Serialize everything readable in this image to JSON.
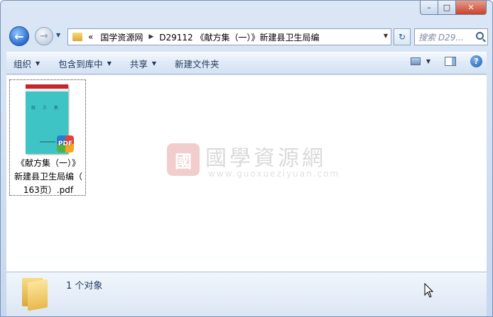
{
  "window": {
    "caption": {
      "minimize": "–",
      "maximize": "□",
      "close": "✕"
    }
  },
  "nav": {
    "back_glyph": "←",
    "forward_glyph": "→",
    "breadcrumb": [
      "国学资源网",
      "D29112 《献方集（一）》新建县卫生局编"
    ],
    "breadcrumb_prefix": "«",
    "refresh_glyph": "↻",
    "search_placeholder": "搜索 D29..."
  },
  "toolbar": {
    "organize": "组织",
    "include_library": "包含到库中",
    "share": "共享",
    "new_folder": "新建文件夹",
    "help": "?"
  },
  "content": {
    "file": {
      "name_lines": [
        "《献方集（一）》",
        "新建县卫生局编（",
        "163页）.pdf"
      ],
      "thumb_title": "献 方 集",
      "badge": "PDF"
    },
    "watermark": {
      "seal": "國",
      "text": "國學資源網",
      "url": "www.guoxueziyuan.com"
    }
  },
  "details": {
    "count_text": "1 个对象"
  }
}
